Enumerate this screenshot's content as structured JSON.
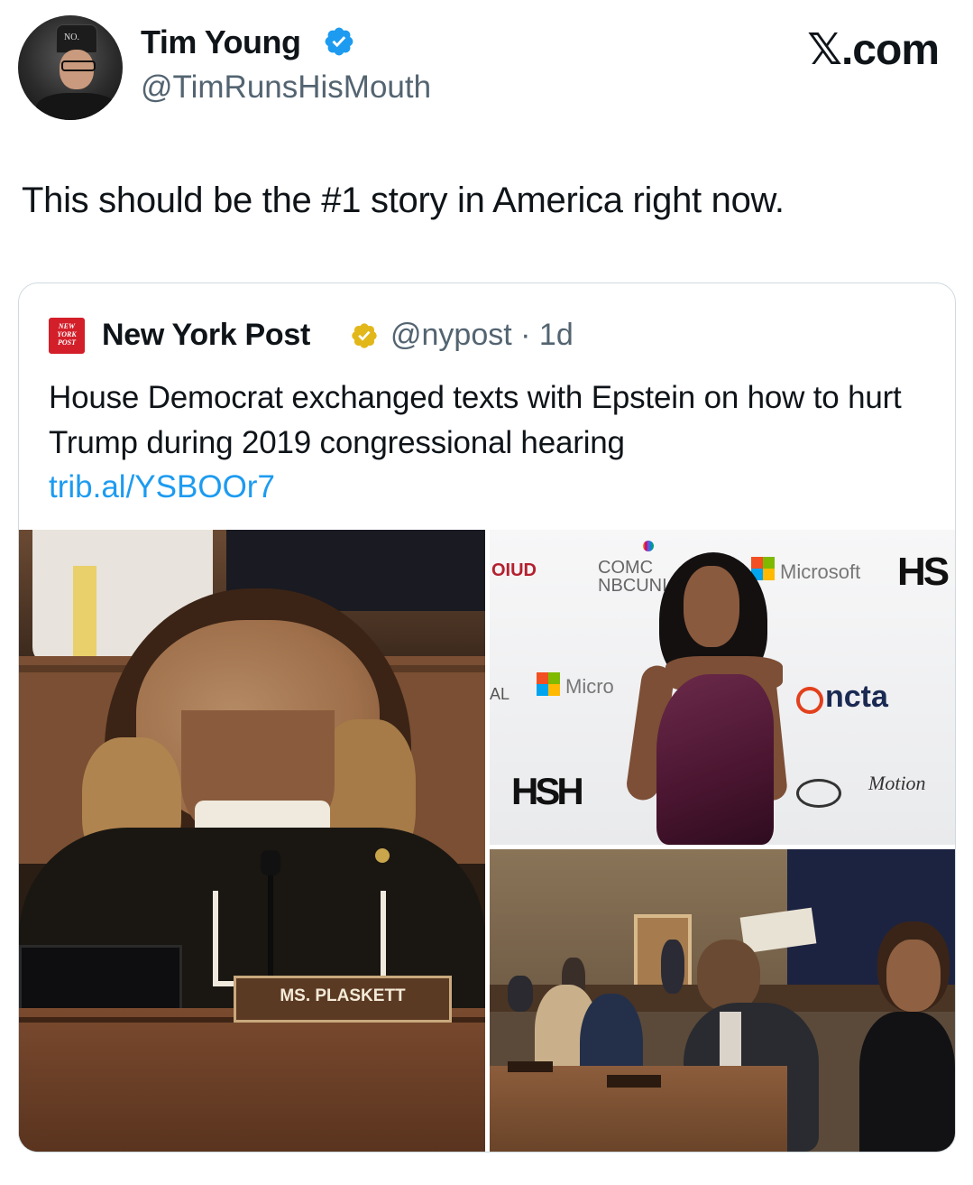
{
  "author": {
    "name": "Tim Young",
    "handle": "@TimRunsHisMouth",
    "avatar_hat_text": "NO.",
    "verified_color": "#1d9bf0"
  },
  "brand": "𝕏.com",
  "tweet_text": "This should be the #1 story in America right now.",
  "quote": {
    "source_name": "New York Post",
    "logo_text": "NEW YORK POST",
    "handle_time": "@nypost · 1d",
    "headline": "House Democrat exchanged texts with Epstein on how to hurt Trump during 2019 congressional hearing",
    "link": "trib.al/YSBOOr7",
    "badge_color": "#e2b719"
  },
  "media": {
    "nameplate": "MS. PLASKETT",
    "backdrop_logos": [
      "OUD",
      "COMC",
      "NBCUNI",
      "Microsoft",
      "HS",
      "Micro",
      "ncta",
      "HSH",
      "AL"
    ]
  },
  "colors": {
    "link": "#1d9bf0",
    "secondary_text": "#536471",
    "border": "#cfd9de"
  }
}
